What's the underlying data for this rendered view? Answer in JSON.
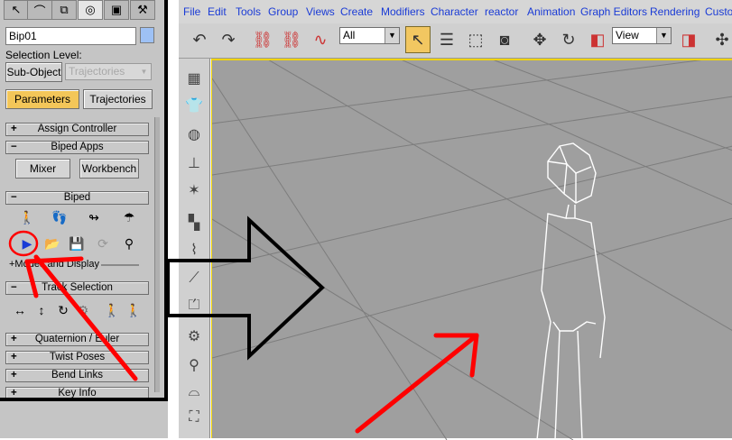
{
  "left_panel": {
    "tabs": [
      {
        "icon": "create-arrow-icon"
      },
      {
        "icon": "modify-curve-icon"
      },
      {
        "icon": "hierarchy-icon"
      },
      {
        "icon": "motion-icon"
      },
      {
        "icon": "display-icon"
      },
      {
        "icon": "utilities-hammer-icon"
      }
    ],
    "name_field": "Bip01",
    "selection_level_label": "Selection Level:",
    "sub_object_label": "Sub-Object",
    "sub_object_dropdown": "Trajectories",
    "parameters_label": "Parameters",
    "trajectories_label": "Trajectories",
    "rollouts": {
      "assign_controller": "Assign Controller",
      "biped_apps": "Biped Apps",
      "mixer": "Mixer",
      "workbench": "Workbench",
      "biped": "Biped",
      "modes_display": "+Modes and Display",
      "track_selection": "Track Selection",
      "quaternion_euler": "Quaternion / Euler",
      "twist_poses": "Twist Poses",
      "bend_links": "Bend Links",
      "key_info": "Key Info"
    },
    "signs": {
      "plus": "+",
      "minus": "−"
    }
  },
  "menubar": {
    "items": [
      "File",
      "Edit",
      "Tools",
      "Group",
      "Views",
      "Create",
      "Modifiers",
      "Character",
      "reactor",
      "Animation",
      "Graph Editors",
      "Rendering",
      "Custo"
    ]
  },
  "toolbar": {
    "filter_combo": "All",
    "view_combo": "View"
  },
  "colors": {
    "menu_text": "#1a3bd6",
    "active_yellow": "#f3c659",
    "viewport_bg": "#9f9f9f",
    "viewport_border": "#f1d400",
    "annotation_red": "#ff0000"
  }
}
